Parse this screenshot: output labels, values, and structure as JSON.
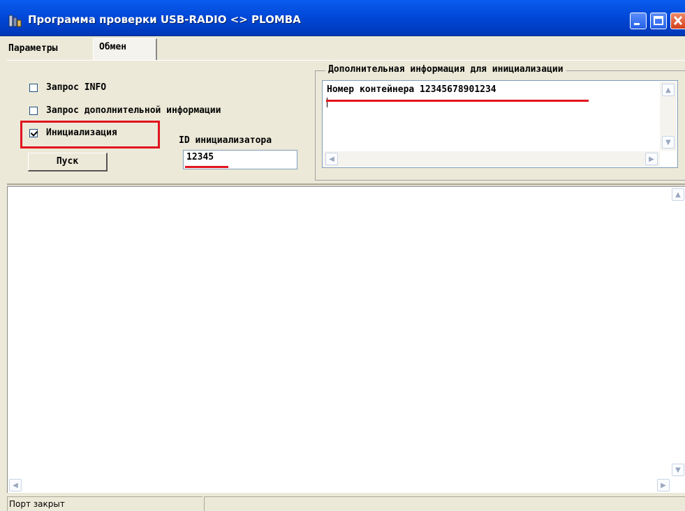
{
  "window": {
    "title": "Программа проверки USB-RADIO <> PLOMBA",
    "icon": "app-icon",
    "controls": [
      "minimize-icon",
      "maximize-icon",
      "close-icon"
    ]
  },
  "tabs": {
    "params": "Параметры",
    "exchange": "Обмен",
    "active": "Обмен"
  },
  "exchange": {
    "request_info": {
      "label": "Запрос INFO",
      "checked": false
    },
    "request_extra": {
      "label": "Запрос дополнительной информации",
      "checked": false
    },
    "init": {
      "label": "Инициализация",
      "checked": true
    },
    "start_button": "Пуск",
    "id_label": "ID инициализатора",
    "id_value": "12345"
  },
  "extra_info": {
    "group_title": "Дополнительная информация для инициализации",
    "text": "Номер контейнера 12345678901234"
  },
  "log": {
    "text": ""
  },
  "statusbar": {
    "port": "Порт закрыт",
    "secondary": ""
  },
  "colors": {
    "highlight": "#e0141e",
    "title_blue": "#0047d6",
    "face": "#ece9d8"
  }
}
